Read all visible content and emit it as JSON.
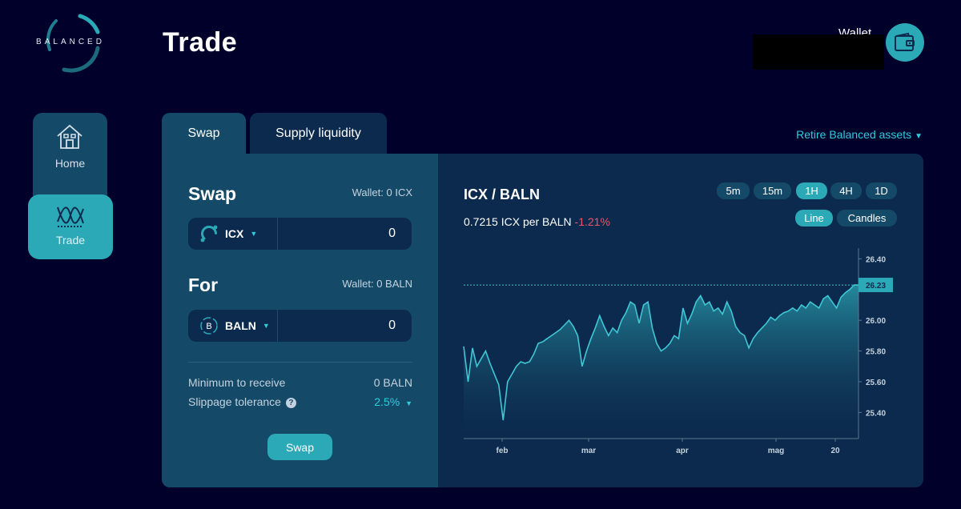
{
  "header": {
    "logo_text": "BALANCED",
    "page_title": "Trade",
    "wallet_label": "Wallet"
  },
  "sidebar": {
    "items": [
      {
        "label": "Home",
        "icon": "home-icon",
        "active": false
      },
      {
        "label": "Trade",
        "icon": "trade-icon",
        "active": true
      }
    ]
  },
  "tabs": [
    {
      "label": "Swap",
      "active": true
    },
    {
      "label": "Supply liquidity",
      "active": false
    }
  ],
  "retire_link": "Retire Balanced assets",
  "swap": {
    "title": "Swap",
    "wallet": "Wallet: 0 ICX",
    "token": "ICX",
    "value": "0"
  },
  "for": {
    "title": "For",
    "wallet": "Wallet: 0 BALN",
    "token": "BALN",
    "value": "0"
  },
  "details": {
    "min_receive_label": "Minimum to receive",
    "min_receive_value": "0 BALN",
    "slippage_label": "Slippage tolerance",
    "slippage_value": "2.5%"
  },
  "swap_button": "Swap",
  "chart_panel": {
    "pair": "ICX / BALN",
    "price": "0.7215 ICX per BALN",
    "change": "-1.21%",
    "timeframes": [
      "5m",
      "15m",
      "1H",
      "4H",
      "1D"
    ],
    "active_timeframe": "1H",
    "chart_types": [
      "Line",
      "Candles"
    ],
    "active_chart_type": "Line"
  },
  "colors": {
    "background": "#01002a",
    "panel_primary": "#144a68",
    "panel_secondary": "#0c2a4d",
    "accent": "#2ca9b7",
    "link": "#2fccdc",
    "negative": "#f05365"
  },
  "chart_data": {
    "type": "area",
    "x_tick_labels": [
      "feb",
      "mar",
      "apr",
      "mag",
      "20"
    ],
    "y_tick_labels": [
      "26.40",
      "26.00",
      "25.80",
      "25.60",
      "25.40"
    ],
    "y_ticks": [
      26.4,
      26.0,
      25.8,
      25.6,
      25.4
    ],
    "ylim": [
      25.23,
      26.47
    ],
    "current_value": 26.23,
    "current_label": "26.23",
    "values": [
      25.83,
      25.6,
      25.82,
      25.7,
      25.75,
      25.8,
      25.72,
      25.65,
      25.58,
      25.35,
      25.6,
      25.65,
      25.7,
      25.73,
      25.72,
      25.73,
      25.78,
      25.85,
      25.86,
      25.88,
      25.9,
      25.92,
      25.94,
      25.97,
      26.0,
      25.96,
      25.9,
      25.7,
      25.8,
      25.88,
      25.95,
      26.03,
      25.96,
      25.9,
      25.95,
      25.92,
      26.0,
      26.05,
      26.12,
      26.1,
      25.98,
      26.1,
      26.12,
      25.95,
      25.85,
      25.8,
      25.82,
      25.85,
      25.9,
      25.88,
      26.08,
      25.98,
      26.04,
      26.12,
      26.16,
      26.1,
      26.12,
      26.06,
      26.08,
      26.04,
      26.12,
      26.06,
      25.96,
      25.92,
      25.9,
      25.82,
      25.88,
      25.92,
      25.95,
      25.98,
      26.02,
      26.0,
      26.03,
      26.05,
      26.06,
      26.08,
      26.06,
      26.1,
      26.08,
      26.12,
      26.1,
      26.08,
      26.14,
      26.16,
      26.12,
      26.08,
      26.15,
      26.18,
      26.2,
      26.23,
      26.23
    ]
  }
}
